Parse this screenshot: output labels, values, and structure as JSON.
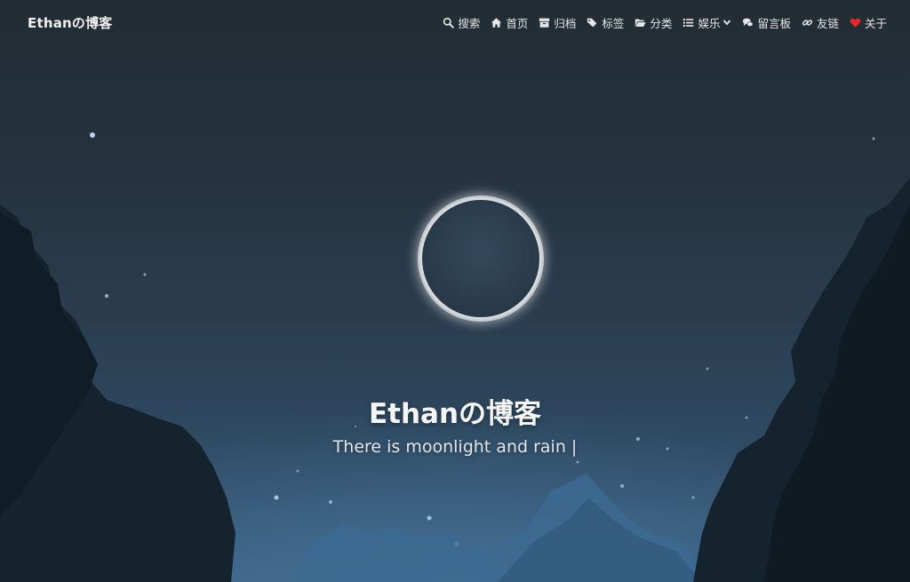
{
  "brand": {
    "title": "Ethanの博客"
  },
  "nav": {
    "items": [
      {
        "label": "搜索",
        "icon": "search-icon"
      },
      {
        "label": "首页",
        "icon": "home-icon"
      },
      {
        "label": "归档",
        "icon": "archive-icon"
      },
      {
        "label": "标签",
        "icon": "tags-icon"
      },
      {
        "label": "分类",
        "icon": "folder-open-icon"
      },
      {
        "label": "娱乐",
        "icon": "list-icon",
        "dropdown": true
      },
      {
        "label": "留言板",
        "icon": "comments-icon"
      },
      {
        "label": "友链",
        "icon": "link-icon"
      },
      {
        "label": "关于",
        "icon": "heart-icon",
        "icon_color": "#e8262b"
      }
    ]
  },
  "hero": {
    "title": "Ethanの博客",
    "subtitle": "There is moonlight and rain |"
  },
  "colors": {
    "nav_text": "#e6e6e6",
    "heart": "#e8262b",
    "sky_top": "#222c33",
    "sky_bottom": "#3a5f80"
  }
}
